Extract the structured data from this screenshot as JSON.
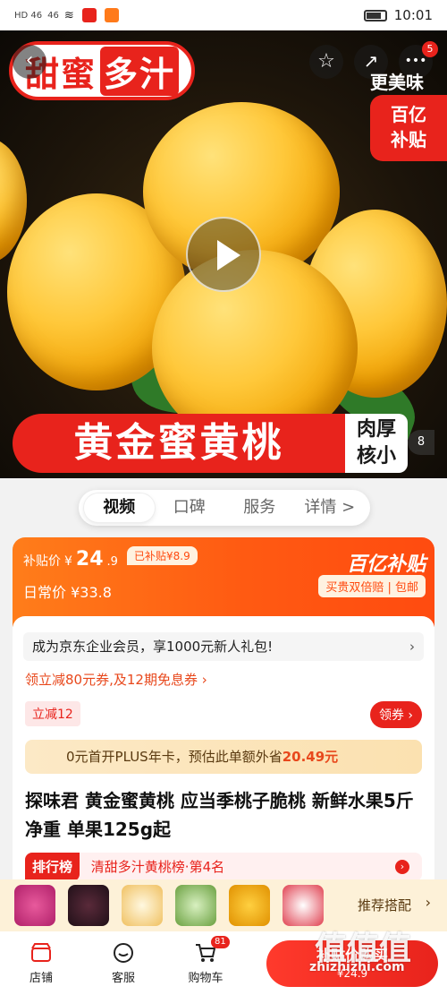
{
  "status_bar": {
    "signal_label_1": "HD 46",
    "signal_label_2": "46",
    "time": "10:01"
  },
  "hero": {
    "slogan_left": "甜蜜",
    "slogan_right": "多汁",
    "tastier": "更美味",
    "subsidy_tag_line1": "百亿",
    "subsidy_tag_line2": "补贴",
    "banner_text": "黄金蜜黄桃",
    "side_tag_line1": "肉厚",
    "side_tag_line2": "核小",
    "image_counter": "8",
    "message_badge": "5"
  },
  "tabs": [
    {
      "label": "视频",
      "active": true
    },
    {
      "label": "口碑",
      "active": false
    },
    {
      "label": "服务",
      "active": false
    },
    {
      "label": "详情 >",
      "active": false
    }
  ],
  "price": {
    "subsidy_label": "补贴价",
    "subsidy_currency": "¥",
    "subsidy_int": "24",
    "subsidy_frac": ".9",
    "subsidized_amount": "已补贴¥8.9",
    "daily_price": "日常价 ¥33.8",
    "brand": "百亿补贴",
    "guarantee": "买贵双倍赔 | 包邮"
  },
  "promo": {
    "enterprise": "成为京东企业会员，享1000元新人礼包!",
    "enterprise_chevron": "›",
    "coupon_line": "领立减80元券,及12期免息券 ›",
    "lijian": "立减12",
    "lingquan": "领券 ›",
    "plus_prefix": "0元首开PLUS年卡，预估此单额外省",
    "plus_amount": "20.49元"
  },
  "product": {
    "title": "探味君 黄金蜜黄桃 应当季桃子脆桃 新鲜水果5斤净重 单果125g起"
  },
  "ranking": {
    "tag": "排行榜",
    "text": "清甜多汁黄桃榜·第4名",
    "arrow": "›"
  },
  "recommend": {
    "label": "推荐搭配",
    "chevron": "›"
  },
  "bottom_bar": {
    "store": "店铺",
    "service": "客服",
    "cart": "购物车",
    "cart_count": "81",
    "buy_label": "补贴价购买",
    "buy_price": "¥24.9"
  },
  "watermark": {
    "text": "值值值",
    "url": "zhizhizhi.com"
  },
  "colors": {
    "brand_red": "#e8231c",
    "subsidy_orange": "#ff5a12",
    "plus_gold": "#fbe1b0"
  }
}
